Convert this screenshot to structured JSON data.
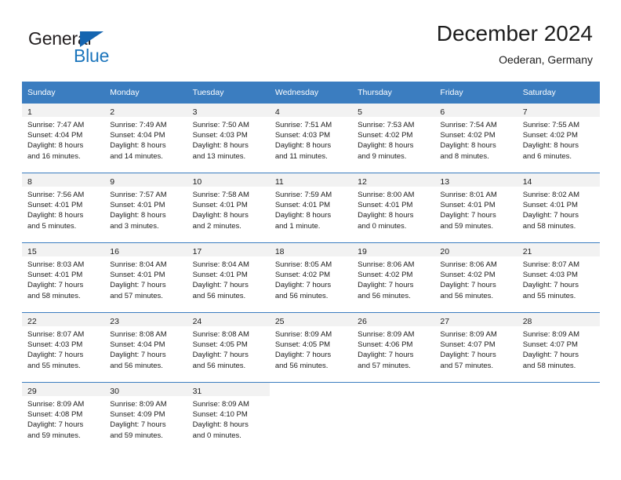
{
  "brand": {
    "name_part1": "General",
    "name_part2": "Blue",
    "triangle_icon": "triangle-icon",
    "accent_color": "#1b75bc"
  },
  "header": {
    "title": "December 2024",
    "subtitle": "Oederan, Germany"
  },
  "calendar": {
    "header_bg": "#3b7dc0",
    "daynum_bg": "#f2f2f2",
    "weekdays": [
      "Sunday",
      "Monday",
      "Tuesday",
      "Wednesday",
      "Thursday",
      "Friday",
      "Saturday"
    ],
    "weeks": [
      [
        {
          "day": "1",
          "sunrise": "Sunrise: 7:47 AM",
          "sunset": "Sunset: 4:04 PM",
          "daylight1": "Daylight: 8 hours",
          "daylight2": "and 16 minutes."
        },
        {
          "day": "2",
          "sunrise": "Sunrise: 7:49 AM",
          "sunset": "Sunset: 4:04 PM",
          "daylight1": "Daylight: 8 hours",
          "daylight2": "and 14 minutes."
        },
        {
          "day": "3",
          "sunrise": "Sunrise: 7:50 AM",
          "sunset": "Sunset: 4:03 PM",
          "daylight1": "Daylight: 8 hours",
          "daylight2": "and 13 minutes."
        },
        {
          "day": "4",
          "sunrise": "Sunrise: 7:51 AM",
          "sunset": "Sunset: 4:03 PM",
          "daylight1": "Daylight: 8 hours",
          "daylight2": "and 11 minutes."
        },
        {
          "day": "5",
          "sunrise": "Sunrise: 7:53 AM",
          "sunset": "Sunset: 4:02 PM",
          "daylight1": "Daylight: 8 hours",
          "daylight2": "and 9 minutes."
        },
        {
          "day": "6",
          "sunrise": "Sunrise: 7:54 AM",
          "sunset": "Sunset: 4:02 PM",
          "daylight1": "Daylight: 8 hours",
          "daylight2": "and 8 minutes."
        },
        {
          "day": "7",
          "sunrise": "Sunrise: 7:55 AM",
          "sunset": "Sunset: 4:02 PM",
          "daylight1": "Daylight: 8 hours",
          "daylight2": "and 6 minutes."
        }
      ],
      [
        {
          "day": "8",
          "sunrise": "Sunrise: 7:56 AM",
          "sunset": "Sunset: 4:01 PM",
          "daylight1": "Daylight: 8 hours",
          "daylight2": "and 5 minutes."
        },
        {
          "day": "9",
          "sunrise": "Sunrise: 7:57 AM",
          "sunset": "Sunset: 4:01 PM",
          "daylight1": "Daylight: 8 hours",
          "daylight2": "and 3 minutes."
        },
        {
          "day": "10",
          "sunrise": "Sunrise: 7:58 AM",
          "sunset": "Sunset: 4:01 PM",
          "daylight1": "Daylight: 8 hours",
          "daylight2": "and 2 minutes."
        },
        {
          "day": "11",
          "sunrise": "Sunrise: 7:59 AM",
          "sunset": "Sunset: 4:01 PM",
          "daylight1": "Daylight: 8 hours",
          "daylight2": "and 1 minute."
        },
        {
          "day": "12",
          "sunrise": "Sunrise: 8:00 AM",
          "sunset": "Sunset: 4:01 PM",
          "daylight1": "Daylight: 8 hours",
          "daylight2": "and 0 minutes."
        },
        {
          "day": "13",
          "sunrise": "Sunrise: 8:01 AM",
          "sunset": "Sunset: 4:01 PM",
          "daylight1": "Daylight: 7 hours",
          "daylight2": "and 59 minutes."
        },
        {
          "day": "14",
          "sunrise": "Sunrise: 8:02 AM",
          "sunset": "Sunset: 4:01 PM",
          "daylight1": "Daylight: 7 hours",
          "daylight2": "and 58 minutes."
        }
      ],
      [
        {
          "day": "15",
          "sunrise": "Sunrise: 8:03 AM",
          "sunset": "Sunset: 4:01 PM",
          "daylight1": "Daylight: 7 hours",
          "daylight2": "and 58 minutes."
        },
        {
          "day": "16",
          "sunrise": "Sunrise: 8:04 AM",
          "sunset": "Sunset: 4:01 PM",
          "daylight1": "Daylight: 7 hours",
          "daylight2": "and 57 minutes."
        },
        {
          "day": "17",
          "sunrise": "Sunrise: 8:04 AM",
          "sunset": "Sunset: 4:01 PM",
          "daylight1": "Daylight: 7 hours",
          "daylight2": "and 56 minutes."
        },
        {
          "day": "18",
          "sunrise": "Sunrise: 8:05 AM",
          "sunset": "Sunset: 4:02 PM",
          "daylight1": "Daylight: 7 hours",
          "daylight2": "and 56 minutes."
        },
        {
          "day": "19",
          "sunrise": "Sunrise: 8:06 AM",
          "sunset": "Sunset: 4:02 PM",
          "daylight1": "Daylight: 7 hours",
          "daylight2": "and 56 minutes."
        },
        {
          "day": "20",
          "sunrise": "Sunrise: 8:06 AM",
          "sunset": "Sunset: 4:02 PM",
          "daylight1": "Daylight: 7 hours",
          "daylight2": "and 56 minutes."
        },
        {
          "day": "21",
          "sunrise": "Sunrise: 8:07 AM",
          "sunset": "Sunset: 4:03 PM",
          "daylight1": "Daylight: 7 hours",
          "daylight2": "and 55 minutes."
        }
      ],
      [
        {
          "day": "22",
          "sunrise": "Sunrise: 8:07 AM",
          "sunset": "Sunset: 4:03 PM",
          "daylight1": "Daylight: 7 hours",
          "daylight2": "and 55 minutes."
        },
        {
          "day": "23",
          "sunrise": "Sunrise: 8:08 AM",
          "sunset": "Sunset: 4:04 PM",
          "daylight1": "Daylight: 7 hours",
          "daylight2": "and 56 minutes."
        },
        {
          "day": "24",
          "sunrise": "Sunrise: 8:08 AM",
          "sunset": "Sunset: 4:05 PM",
          "daylight1": "Daylight: 7 hours",
          "daylight2": "and 56 minutes."
        },
        {
          "day": "25",
          "sunrise": "Sunrise: 8:09 AM",
          "sunset": "Sunset: 4:05 PM",
          "daylight1": "Daylight: 7 hours",
          "daylight2": "and 56 minutes."
        },
        {
          "day": "26",
          "sunrise": "Sunrise: 8:09 AM",
          "sunset": "Sunset: 4:06 PM",
          "daylight1": "Daylight: 7 hours",
          "daylight2": "and 57 minutes."
        },
        {
          "day": "27",
          "sunrise": "Sunrise: 8:09 AM",
          "sunset": "Sunset: 4:07 PM",
          "daylight1": "Daylight: 7 hours",
          "daylight2": "and 57 minutes."
        },
        {
          "day": "28",
          "sunrise": "Sunrise: 8:09 AM",
          "sunset": "Sunset: 4:07 PM",
          "daylight1": "Daylight: 7 hours",
          "daylight2": "and 58 minutes."
        }
      ],
      [
        {
          "day": "29",
          "sunrise": "Sunrise: 8:09 AM",
          "sunset": "Sunset: 4:08 PM",
          "daylight1": "Daylight: 7 hours",
          "daylight2": "and 59 minutes."
        },
        {
          "day": "30",
          "sunrise": "Sunrise: 8:09 AM",
          "sunset": "Sunset: 4:09 PM",
          "daylight1": "Daylight: 7 hours",
          "daylight2": "and 59 minutes."
        },
        {
          "day": "31",
          "sunrise": "Sunrise: 8:09 AM",
          "sunset": "Sunset: 4:10 PM",
          "daylight1": "Daylight: 8 hours",
          "daylight2": "and 0 minutes."
        },
        {
          "day": "",
          "sunrise": "",
          "sunset": "",
          "daylight1": "",
          "daylight2": ""
        },
        {
          "day": "",
          "sunrise": "",
          "sunset": "",
          "daylight1": "",
          "daylight2": ""
        },
        {
          "day": "",
          "sunrise": "",
          "sunset": "",
          "daylight1": "",
          "daylight2": ""
        },
        {
          "day": "",
          "sunrise": "",
          "sunset": "",
          "daylight1": "",
          "daylight2": ""
        }
      ]
    ]
  }
}
